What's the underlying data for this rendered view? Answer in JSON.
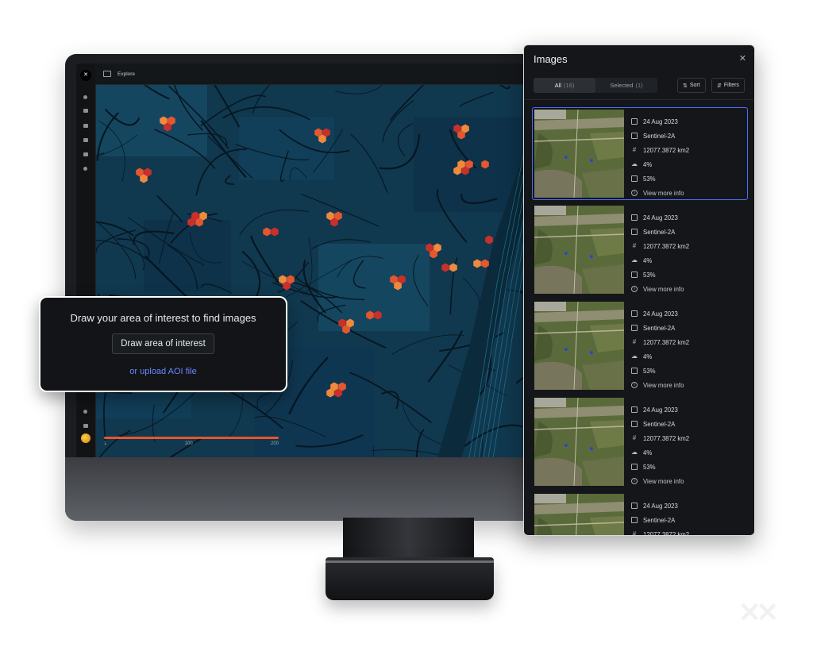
{
  "app": {
    "logo_text": "✕",
    "page_title": "Explore",
    "sidebar_icons": [
      "search-icon",
      "layers-icon",
      "map-icon",
      "share-icon",
      "building-icon",
      "bell-icon",
      "help-icon",
      "book-icon",
      "avatar"
    ]
  },
  "map": {
    "accent": "#e8552b",
    "hex_colors": [
      "#ef8a3c",
      "#e4572e",
      "#c9302c"
    ],
    "slider": {
      "min_label": "1",
      "mid_label": "100",
      "max_label": "200"
    }
  },
  "aoi_card": {
    "title": "Draw your area of interest to find images",
    "button_label": "Draw area of interest",
    "link_label": "or upload AOI file"
  },
  "panel": {
    "title": "Images",
    "close_icon": "close-icon",
    "tabs": [
      {
        "label": "All",
        "count": "(16)"
      },
      {
        "label": "Selected",
        "count": "(1)"
      }
    ],
    "sort_label": "Sort",
    "filters_label": "Filters",
    "accent": "#4b6dff",
    "images": [
      {
        "date": "24 Aug 2023",
        "sensor": "Sentinel-2A",
        "area": "12077.3872 km2",
        "cloud": "4%",
        "coverage": "53%",
        "more": "View more info",
        "selected": true
      },
      {
        "date": "24 Aug 2023",
        "sensor": "Sentinel-2A",
        "area": "12077.3872 km2",
        "cloud": "4%",
        "coverage": "53%",
        "more": "View more info",
        "selected": false
      },
      {
        "date": "24 Aug 2023",
        "sensor": "Sentinel-2A",
        "area": "12077.3872 km2",
        "cloud": "4%",
        "coverage": "53%",
        "more": "View more info",
        "selected": false
      },
      {
        "date": "24 Aug 2023",
        "sensor": "Sentinel-2A",
        "area": "12077.3872 km2",
        "cloud": "4%",
        "coverage": "53%",
        "more": "View more info",
        "selected": false
      },
      {
        "date": "24 Aug 2023",
        "sensor": "Sentinel-2A",
        "area": "12077.3872 km2",
        "cloud": "",
        "coverage": "",
        "more": "",
        "selected": false
      }
    ]
  }
}
